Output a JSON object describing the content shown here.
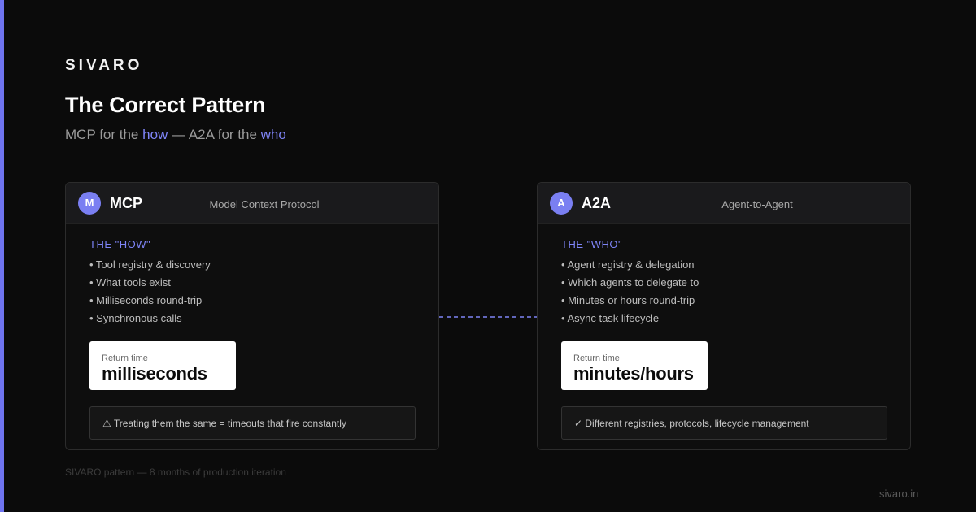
{
  "brand": "SIVARO",
  "title": "The Correct Pattern",
  "subtitle": {
    "prefix": "MCP for the ",
    "how": "how",
    "middle": " — A2A for the ",
    "who": "who"
  },
  "cards": [
    {
      "badge": "M",
      "name": "MCP",
      "description": "Model Context Protocol",
      "section": "THE \"HOW\"",
      "bullets": [
        "• Tool registry & discovery",
        "• What tools exist",
        "• Milliseconds round-trip",
        "• Synchronous calls"
      ],
      "return_label": "Return time",
      "return_value": "milliseconds",
      "note": "⚠ Treating them the same = timeouts that fire constantly"
    },
    {
      "badge": "A",
      "name": "A2A",
      "description": "Agent-to-Agent",
      "section": "THE \"WHO\"",
      "bullets": [
        "• Agent registry & delegation",
        "• Which agents to delegate to",
        "• Minutes or hours round-trip",
        "• Async task lifecycle"
      ],
      "return_label": "Return time",
      "return_value": "minutes/hours",
      "note": "✓ Different registries, protocols, lifecycle management"
    }
  ],
  "footer": "SIVARO pattern — 8 months of production iteration",
  "site": "sivaro.in",
  "colors": {
    "accent": "#7e84f6",
    "background": "#0b0b0b",
    "card_header": "#1a1a1c"
  }
}
